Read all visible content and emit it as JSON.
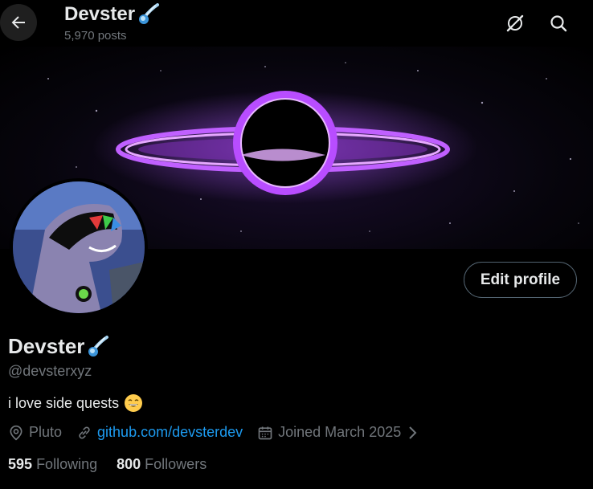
{
  "header": {
    "display_name": "Devster",
    "post_count": "5,970 posts",
    "icons": [
      "back-arrow-icon",
      "grok-icon",
      "search-icon"
    ]
  },
  "banner": {
    "description_icon": "black-hole-banner"
  },
  "profile": {
    "edit_button_label": "Edit profile",
    "display_name": "Devster",
    "handle": "@devsterxyz",
    "bio": "i love side quests",
    "location": "Pluto",
    "website": "github.com/devsterdev",
    "joined": "Joined March 2025",
    "following_count": "595",
    "following_label": "Following",
    "followers_count": "800",
    "followers_label": "Followers"
  },
  "colors": {
    "background": "#000000",
    "text": "#e7e9ea",
    "secondary": "#71767b",
    "link": "#1d9bf0"
  }
}
